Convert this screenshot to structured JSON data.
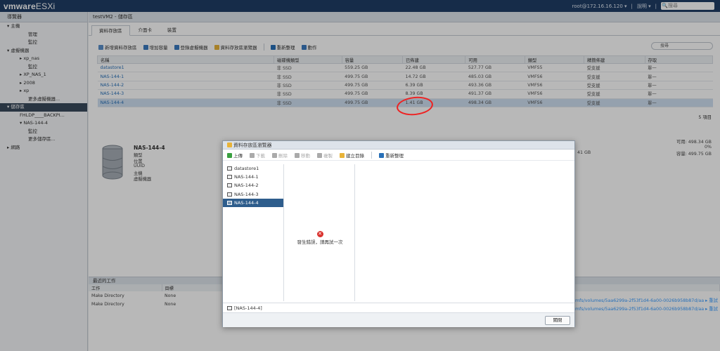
{
  "topbar": {
    "brand": "vmware",
    "product": "ESXi",
    "user": "root@172.16.16.120 ▾",
    "help": "說明 ▾",
    "search_placeholder": "搜尋"
  },
  "sidebar": {
    "title": "導覽器",
    "items": [
      {
        "label": "▾ 主機",
        "level": 0
      },
      {
        "label": "管理",
        "level": 2
      },
      {
        "label": "監控",
        "level": 2
      },
      {
        "label": "▾ 虛擬機器",
        "level": 0
      },
      {
        "label": "▸ xp_nas",
        "level": 1
      },
      {
        "label": "監控",
        "level": 2
      },
      {
        "label": "▸ XP_NAS_1",
        "level": 1
      },
      {
        "label": "▸ 2008",
        "level": 1
      },
      {
        "label": "▸ xp",
        "level": 1
      },
      {
        "label": "更多虛擬機器...",
        "level": 2
      },
      {
        "label": "▾ 儲存區",
        "level": 0,
        "selected": true
      },
      {
        "label": "FHLDP____BACKPI...",
        "level": 1
      },
      {
        "label": "▾ NAS-144-4",
        "level": 1
      },
      {
        "label": "監控",
        "level": 2
      },
      {
        "label": "更多儲存區...",
        "level": 2
      },
      {
        "label": "▸ 網路",
        "level": 0
      }
    ]
  },
  "main": {
    "header": "testVM2 - 儲存區",
    "tabs": [
      "資料存放區",
      "介面卡",
      "裝置"
    ],
    "toolbar": [
      "新增資料存放區",
      "增加容量",
      "登錄虛擬機器",
      "資料存放區瀏覽器",
      "重新整理",
      "動作"
    ],
    "filter_placeholder": "搜尋",
    "columns": [
      "名稱",
      "磁碟機類型",
      "容量",
      "已佈建",
      "可用",
      "類型",
      "精簡佈建",
      "存取"
    ],
    "rows": [
      [
        "datastore1",
        "非 SSD",
        "559.25 GB",
        "22.48 GB",
        "527.77 GB",
        "VMFS5",
        "受支援",
        "單一"
      ],
      [
        "NAS-144-1",
        "非 SSD",
        "499.75 GB",
        "14.72 GB",
        "485.03 GB",
        "VMFS6",
        "受支援",
        "單一"
      ],
      [
        "NAS-144-2",
        "非 SSD",
        "499.75 GB",
        "6.39 GB",
        "493.36 GB",
        "VMFS6",
        "受支援",
        "單一"
      ],
      [
        "NAS-144-3",
        "非 SSD",
        "499.75 GB",
        "8.39 GB",
        "491.37 GB",
        "VMFS6",
        "受支援",
        "單一"
      ],
      [
        "NAS-144-4",
        "非 SSD",
        "499.75 GB",
        "1.41 GB",
        "498.34 GB",
        "VMFS6",
        "受支援",
        "單一"
      ]
    ],
    "count": "5 項目",
    "detail": {
      "name": "NAS-144-4",
      "keys": [
        "類型",
        "位置",
        "UUID",
        "主機",
        "虛擬機器"
      ]
    },
    "right_side": {
      "avail_label": "可用: 498.34 GB",
      "pct": "0%",
      "capacity_label": "容量: 499.75 GB",
      "partial": "41 GB"
    },
    "recent": {
      "title": "最近的工作",
      "columns": [
        "工作",
        "目標"
      ],
      "rows": [
        [
          "Make Directory",
          "None"
        ],
        [
          "Make Directory",
          "None"
        ]
      ],
      "right_rows": [
        "mfs/volumes/5aa6299a-2f53f1d4-6a00-0026b958b87d/aa  ▸ 重試",
        "mfs/volumes/5aa6299a-2f53f1d4-6a00-0026b958b87d/aa  ▸ 重試"
      ]
    }
  },
  "dialog": {
    "title": "資料存放區瀏覽器",
    "toolbar": [
      {
        "label": "上傳",
        "disabled": false
      },
      {
        "label": "下載",
        "disabled": true
      },
      {
        "label": "刪除",
        "disabled": true
      },
      {
        "label": "移動",
        "disabled": true
      },
      {
        "label": "複製",
        "disabled": true
      },
      {
        "label": "建立目錄",
        "disabled": false
      },
      {
        "label": "重新整理",
        "disabled": false
      }
    ],
    "datastores": [
      "datastore1",
      "NAS-144-1",
      "NAS-144-2",
      "NAS-144-3",
      "NAS-144-4"
    ],
    "selected_index": 4,
    "error": "發生錯誤，請再試一次",
    "path": "[NAS-144-4]",
    "close_label": "關閉"
  }
}
